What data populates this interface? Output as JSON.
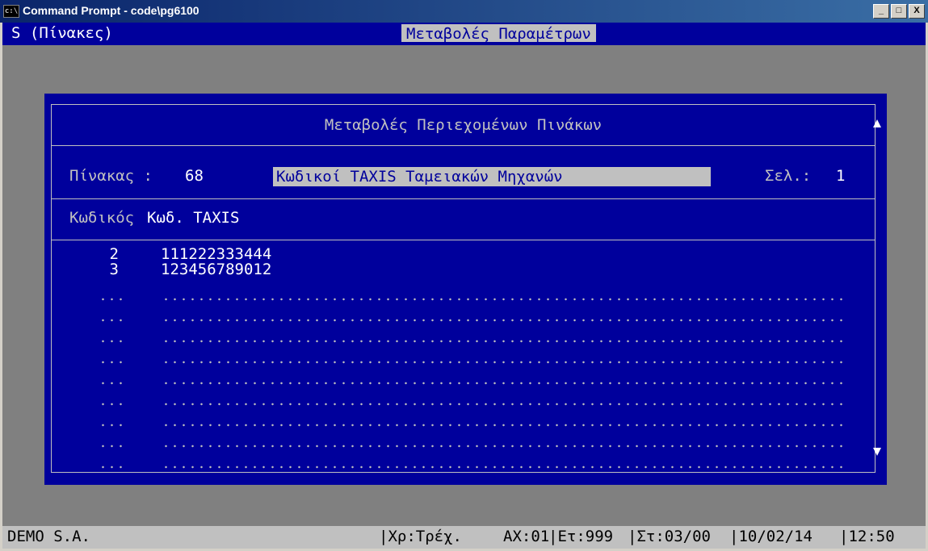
{
  "window": {
    "icon_text": "c:\\",
    "title": "Command Prompt - code\\pg6100",
    "minimize": "_",
    "maximize": "□",
    "close": "X"
  },
  "header": {
    "left": "S (Πίνακες)",
    "center": "Μεταβολές Παραμέτρων"
  },
  "dialog": {
    "title": "Μεταβολές Περιεχομένων Πινάκων",
    "table_label": "Πίνακας :",
    "table_number": "68",
    "table_name": "Κωδικοί TAXIS Ταμειακών Μηχανών",
    "page_label": "Σελ.:",
    "page_number": "1",
    "columns": {
      "code": "Κωδικός",
      "taxis": "Κωδ. TAXIS"
    },
    "rows": [
      {
        "code": "2",
        "taxis": "111222333444"
      },
      {
        "code": "3",
        "taxis": "123456789012"
      }
    ],
    "empty_row_count": 9
  },
  "status": {
    "company": "DEMO S.A.",
    "period": "|Χρ:Τρέχ.",
    "branch": "ΑΧ:01",
    "year": "|Ετ:999",
    "station": "|Στ:03/00",
    "date": "|10/02/14",
    "time": "|12:50"
  }
}
